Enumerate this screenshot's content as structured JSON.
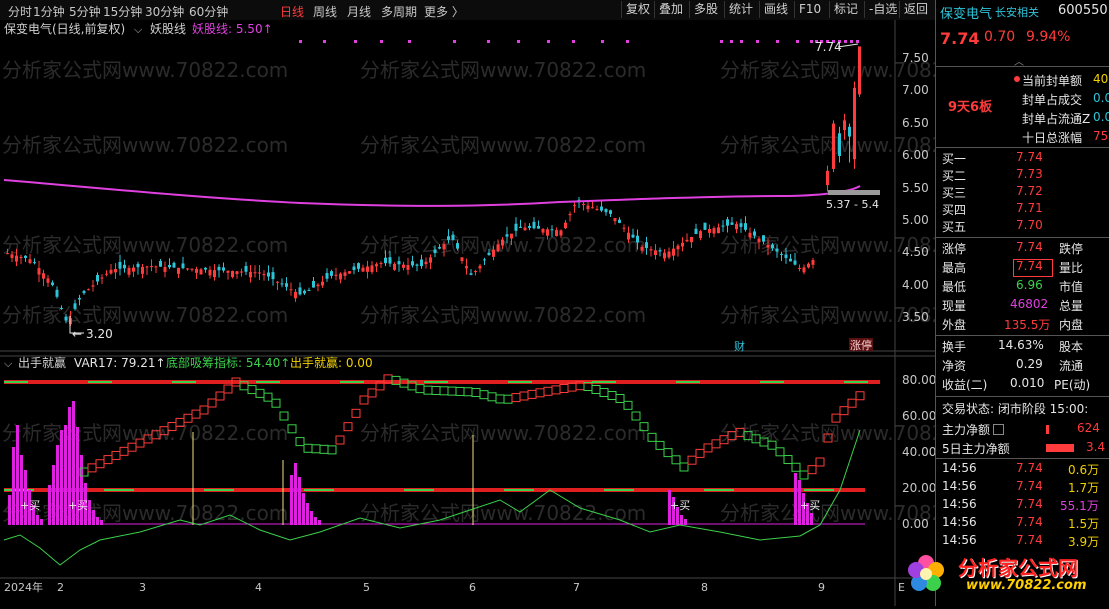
{
  "toolbar": {
    "timeframes": [
      "分时",
      "1分钟",
      "5分钟",
      "15分钟",
      "30分钟",
      "60分钟",
      "日线",
      "周线",
      "月线",
      "多周期",
      "更多 〉"
    ],
    "active": "日线",
    "buttons": [
      "复权",
      "叠加",
      "多股",
      "统计",
      "画线",
      "F10",
      "标记",
      "-自选",
      "返回"
    ]
  },
  "main_chart": {
    "title": "保变电气(日线,前复权)",
    "indicator_name": "妖股线",
    "indicator_label": "妖股线: 5.50↑",
    "high_label": "7.74",
    "low_label": "3.20",
    "range_label": "5.37 - 5.4",
    "watermark": "分析家公式网www.70822.com",
    "badge_cai": "财",
    "badge_zhangting": "涨停",
    "chart_data": {
      "type": "candlestick",
      "yaxis_ticks": [
        "7.50",
        "7.00",
        "6.50",
        "6.00",
        "5.50",
        "5.00",
        "4.50",
        "4.00",
        "3.50"
      ],
      "ylim": [
        3.2,
        7.9
      ]
    }
  },
  "sub_chart": {
    "title": "出手就赢",
    "var17_label": "VAR17: 79.21↑",
    "dibu_label": "底部吸筹指标: 54.40↑",
    "chushou_label": "出手就赢: 0.00",
    "yaxis_ticks": [
      "80.00",
      "60.00",
      "40.00",
      "20.00",
      "0.00"
    ],
    "buy_label": "买",
    "xaxis_labels": [
      "2024年",
      "2",
      "3",
      "4",
      "5",
      "6",
      "7",
      "8",
      "9",
      "E"
    ]
  },
  "quote": {
    "name": "保变电气",
    "related": "长安相关",
    "code": "600550",
    "price": "7.74",
    "change": "0.70",
    "pct": "9.94%",
    "streak": "9天6板",
    "seal_rows": [
      {
        "label": "当前封单额",
        "value": "40"
      },
      {
        "label": "封单占成交",
        "value": "0.0"
      },
      {
        "label": "封单占流通Z",
        "value": "0.0"
      },
      {
        "label": "十日总涨幅",
        "value": "75."
      }
    ],
    "bids": [
      {
        "label": "买一",
        "price": "7.74"
      },
      {
        "label": "买二",
        "price": "7.73"
      },
      {
        "label": "买三",
        "price": "7.72"
      },
      {
        "label": "买四",
        "price": "7.71"
      },
      {
        "label": "买五",
        "price": "7.70"
      }
    ],
    "stats": {
      "zhangting_l": "涨停",
      "zhangting_v": "7.74",
      "dieting_l": "跌停",
      "high_l": "最高",
      "high_v": "7.74",
      "liangbi_l": "量比",
      "low_l": "最低",
      "low_v": "6.96",
      "shizhi_l": "市值",
      "vol_l": "现量",
      "vol_v": "46802",
      "total_l": "总量",
      "outer_l": "外盘",
      "outer_v": "135.5万",
      "inner_l": "内盘"
    },
    "stats2": {
      "huanshou_l": "换手",
      "huanshou_v": "14.63%",
      "guben_l": "股本",
      "jingzi_l": "净资",
      "jingzi_v": "0.29",
      "liutong_l": "流通",
      "shouyi_l": "收益(二)",
      "shouyi_v": "0.010",
      "pe_l": "PE(动)"
    },
    "status_label": "交易状态: 闭市阶段 15:00:",
    "fund_rows": [
      {
        "label": "主力净额",
        "value": "624"
      },
      {
        "label": "5日主力净额",
        "value": "3.4"
      }
    ],
    "ticks": [
      {
        "time": "14:56",
        "price": "7.74",
        "vol": "0.6万"
      },
      {
        "time": "14:56",
        "price": "7.74",
        "vol": "1.7万"
      },
      {
        "time": "14:56",
        "price": "7.74",
        "vol": "55.1万"
      },
      {
        "time": "14:56",
        "price": "7.74",
        "vol": "1.5万"
      },
      {
        "time": "14:56",
        "price": "7.74",
        "vol": "3.9万"
      }
    ],
    "logo_text": "分析家公式网",
    "logo_url": "www.70822.com"
  },
  "colors": {
    "up": "#ff3b3b",
    "down": "#2ec4d8",
    "ma": "#e040e0",
    "green": "#3bd14b"
  }
}
